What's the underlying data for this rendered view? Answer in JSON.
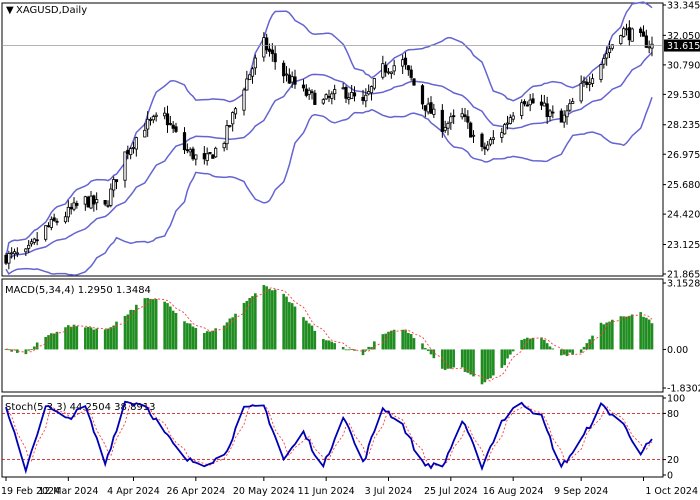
{
  "chart_data": [
    {
      "type": "candlestick",
      "title": "XAGUSD,Daily",
      "symbol": "XAGUSD",
      "timeframe": "Daily",
      "ylim": [
        21.865,
        33.345
      ],
      "yticks": [
        "33.345",
        "32.050",
        "30.790",
        "29.530",
        "28.235",
        "26.975",
        "25.680",
        "24.420",
        "23.125",
        "21.865"
      ],
      "current_price": "31.615",
      "overlays": [
        "Bollinger Bands (upper, middle, lower)"
      ],
      "close_path": [
        [
          "19 Feb 2024",
          22.6
        ],
        [
          "26 Feb 2024",
          22.7
        ],
        [
          "4 Mar 2024",
          23.8
        ],
        [
          "11 Mar 2024",
          24.4
        ],
        [
          "18 Mar 2024",
          25.0
        ],
        [
          "25 Mar 2024",
          24.7
        ],
        [
          "1 Apr 2024",
          27.0
        ],
        [
          "8 Apr 2024",
          28.2
        ],
        [
          "15 Apr 2024",
          28.6
        ],
        [
          "22 Apr 2024",
          27.2
        ],
        [
          "29 Apr 2024",
          26.6
        ],
        [
          "6 May 2024",
          27.6
        ],
        [
          "13 May 2024",
          29.9
        ],
        [
          "20 May 2024",
          31.7
        ],
        [
          "27 May 2024",
          30.4
        ],
        [
          "3 Jun 2024",
          29.6
        ],
        [
          "10 Jun 2024",
          29.2
        ],
        [
          "17 Jun 2024",
          29.7
        ],
        [
          "24 Jun 2024",
          29.1
        ],
        [
          "1 Jul 2024",
          30.6
        ],
        [
          "8 Jul 2024",
          30.9
        ],
        [
          "15 Jul 2024",
          29.2
        ],
        [
          "22 Jul 2024",
          28.2
        ],
        [
          "29 Jul 2024",
          28.6
        ],
        [
          "5 Aug 2024",
          27.1
        ],
        [
          "12 Aug 2024",
          28.0
        ],
        [
          "19 Aug 2024",
          29.4
        ],
        [
          "26 Aug 2024",
          29.0
        ],
        [
          "2 Sep 2024",
          28.3
        ],
        [
          "9 Sep 2024",
          29.8
        ],
        [
          "16 Sep 2024",
          30.9
        ],
        [
          "23 Sep 2024",
          32.3
        ],
        [
          "30 Sep 2024",
          31.9
        ],
        [
          "4 Oct 2024",
          31.6
        ]
      ]
    },
    {
      "type": "bar",
      "title": "MACD(5,34,4) 1.2950 1.3484",
      "name": "MACD",
      "params": "5,34,4",
      "values_text": "1.2950 1.3484",
      "ylim": [
        -1.8302,
        3.1528
      ],
      "yticks": [
        "3.1528",
        "0.00",
        "-1.8302"
      ],
      "histogram_path": [
        [
          "19 Feb 2024",
          0.0
        ],
        [
          "26 Feb 2024",
          -0.2
        ],
        [
          "4 Mar 2024",
          0.6
        ],
        [
          "11 Mar 2024",
          1.1
        ],
        [
          "18 Mar 2024",
          1.1
        ],
        [
          "25 Mar 2024",
          0.9
        ],
        [
          "1 Apr 2024",
          1.6
        ],
        [
          "8 Apr 2024",
          2.4
        ],
        [
          "15 Apr 2024",
          2.3
        ],
        [
          "22 Apr 2024",
          1.4
        ],
        [
          "29 Apr 2024",
          0.8
        ],
        [
          "6 May 2024",
          1.1
        ],
        [
          "13 May 2024",
          2.2
        ],
        [
          "20 May 2024",
          3.0
        ],
        [
          "27 May 2024",
          2.6
        ],
        [
          "3 Jun 2024",
          1.5
        ],
        [
          "10 Jun 2024",
          0.5
        ],
        [
          "17 Jun 2024",
          0.1
        ],
        [
          "24 Jun 2024",
          -0.2
        ],
        [
          "1 Jul 2024",
          0.7
        ],
        [
          "8 Jul 2024",
          1.0
        ],
        [
          "15 Jul 2024",
          0.3
        ],
        [
          "22 Jul 2024",
          -0.9
        ],
        [
          "29 Jul 2024",
          -0.9
        ],
        [
          "5 Aug 2024",
          -1.6
        ],
        [
          "12 Aug 2024",
          -0.9
        ],
        [
          "19 Aug 2024",
          0.5
        ],
        [
          "26 Aug 2024",
          0.6
        ],
        [
          "2 Sep 2024",
          -0.3
        ],
        [
          "9 Sep 2024",
          -0.1
        ],
        [
          "16 Sep 2024",
          1.2
        ],
        [
          "23 Sep 2024",
          1.6
        ],
        [
          "30 Sep 2024",
          1.7
        ],
        [
          "4 Oct 2024",
          1.3
        ]
      ]
    },
    {
      "type": "line",
      "title": "Stoch(5,3,3) 44.2504 38.8913",
      "name": "Stoch",
      "params": "5,3,3",
      "values_text": "44.2504 38.8913",
      "ylim": [
        0,
        100
      ],
      "yticks": [
        "100",
        "80",
        "20",
        "0"
      ],
      "levels": [
        80,
        20
      ],
      "k_path": [
        [
          "19 Feb 2024",
          85
        ],
        [
          "26 Feb 2024",
          8
        ],
        [
          "4 Mar 2024",
          90
        ],
        [
          "11 Mar 2024",
          72
        ],
        [
          "18 Mar 2024",
          88
        ],
        [
          "25 Mar 2024",
          15
        ],
        [
          "1 Apr 2024",
          95
        ],
        [
          "8 Apr 2024",
          92
        ],
        [
          "15 Apr 2024",
          55
        ],
        [
          "22 Apr 2024",
          20
        ],
        [
          "29 Apr 2024",
          15
        ],
        [
          "6 May 2024",
          25
        ],
        [
          "13 May 2024",
          85
        ],
        [
          "20 May 2024",
          90
        ],
        [
          "27 May 2024",
          20
        ],
        [
          "3 Jun 2024",
          55
        ],
        [
          "10 Jun 2024",
          10
        ],
        [
          "17 Jun 2024",
          78
        ],
        [
          "24 Jun 2024",
          15
        ],
        [
          "1 Jul 2024",
          88
        ],
        [
          "8 Jul 2024",
          65
        ],
        [
          "15 Jul 2024",
          15
        ],
        [
          "22 Jul 2024",
          10
        ],
        [
          "29 Jul 2024",
          70
        ],
        [
          "5 Aug 2024",
          12
        ],
        [
          "12 Aug 2024",
          70
        ],
        [
          "19 Aug 2024",
          95
        ],
        [
          "26 Aug 2024",
          75
        ],
        [
          "2 Sep 2024",
          10
        ],
        [
          "9 Sep 2024",
          45
        ],
        [
          "16 Sep 2024",
          90
        ],
        [
          "23 Sep 2024",
          70
        ],
        [
          "30 Sep 2024",
          30
        ],
        [
          "4 Oct 2024",
          44
        ]
      ]
    }
  ],
  "x_axis": {
    "labels": [
      "19 Feb 2024",
      "12 Mar 2024",
      "4 Apr 2024",
      "26 Apr 2024",
      "20 May 2024",
      "11 Jun 2024",
      "3 Jul 2024",
      "25 Jul 2024",
      "16 Aug 2024",
      "9 Sep 2024",
      "1 Oct 2024"
    ]
  },
  "colors": {
    "candle_up": "#000000",
    "candle_body_up": "#ffffff",
    "candle_down": "#000000",
    "bollinger": "#6464d2",
    "macd_histogram": "#1e8c1e",
    "macd_signal": "#ff3c3c",
    "stoch_k": "#0000b4",
    "stoch_d": "#ff3c3c",
    "level_line": "#c80000",
    "price_label_bg": "#000000",
    "price_label_text": "#ffffff"
  }
}
